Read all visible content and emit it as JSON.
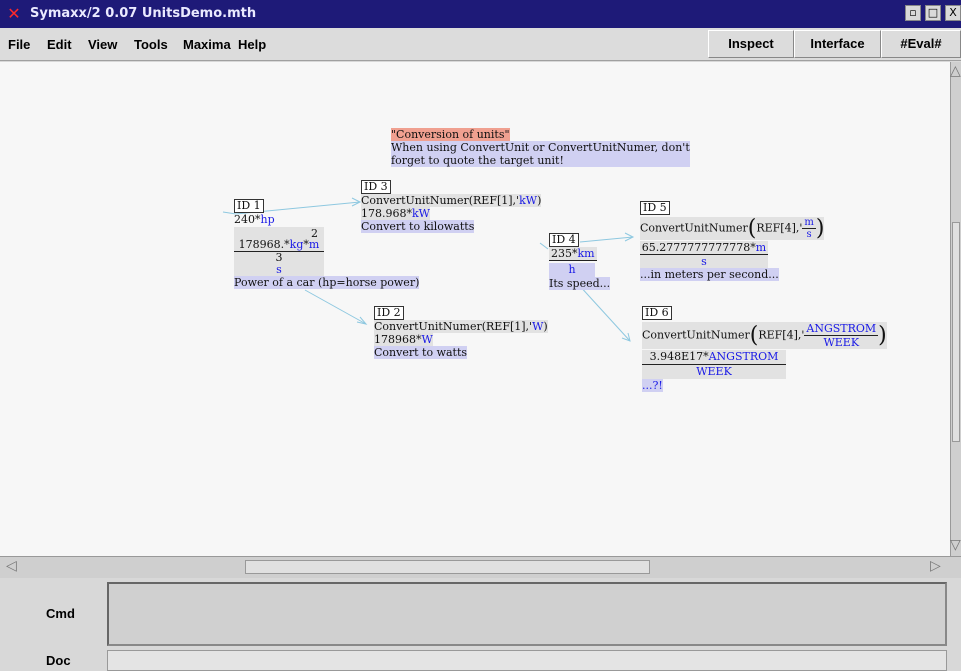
{
  "window": {
    "title": "Symaxx/2 0.07 UnitsDemo.mth",
    "buttons": [
      "▫",
      "□",
      "X"
    ]
  },
  "menu": [
    "File",
    "Edit",
    "View",
    "Tools",
    "Maxima",
    "Help"
  ],
  "toolbar": {
    "inspect": "Inspect",
    "interface": "Interface",
    "eval": "#Eval#"
  },
  "doc": {
    "header_title": "\"Conversion of units\"",
    "header_line1": "When using ConvertUnit or ConvertUnitNumer, don't",
    "header_line2": "forget to quote the target unit!",
    "id1": {
      "label": "ID 1",
      "expr_num": "240*",
      "expr_unit": "hp",
      "res_exp": "2",
      "res_num": "178968.*",
      "res_u1": "kg",
      "res_star": "*",
      "res_u2": "m",
      "res_den_exp": "3",
      "res_den": "s",
      "comment": "Power of a car (hp=horse power)"
    },
    "id2": {
      "label": "ID 2",
      "expr_pre": "ConvertUnitNumer(REF[1],'",
      "expr_unit": "W",
      "expr_post": ")",
      "res_num": "178968*",
      "res_unit": "W",
      "comment": "Convert to watts"
    },
    "id3": {
      "label": "ID 3",
      "expr_pre": "ConvertUnitNumer(REF[1],'",
      "expr_unit": "kW",
      "expr_post": ")",
      "res_num": "178.968*",
      "res_unit": "kW",
      "comment": "Convert to kilowatts"
    },
    "id4": {
      "label": "ID 4",
      "num": "235*",
      "num_unit": "km",
      "den": "h",
      "comment": "Its speed..."
    },
    "id5": {
      "label": "ID 5",
      "expr_pre": "ConvertUnitNumer",
      "expr_ref": "REF[4],'",
      "frac_num": "m",
      "frac_den": "s",
      "res_num": "65.2777777777778*",
      "res_unit": "m",
      "res_den": "s",
      "comment": "...in meters per second..."
    },
    "id6": {
      "label": "ID 6",
      "expr_pre": "ConvertUnitNumer",
      "expr_ref": "REF[4],'",
      "frac_num": "ANGSTROM",
      "frac_den": "WEEK",
      "res_num": "3.948E17*",
      "res_unit": "ANGSTROM",
      "res_den": "WEEK",
      "comment": "...?!"
    }
  },
  "bottom": {
    "cmd_label": "Cmd",
    "doc_label": "Doc"
  },
  "colors": {
    "titlebar": "#1e1a78",
    "unit_blue": "#1a1ae6",
    "comment_bg": "#d0d0f2",
    "title_bg": "#f0a090",
    "connector": "#8ec8e0"
  }
}
